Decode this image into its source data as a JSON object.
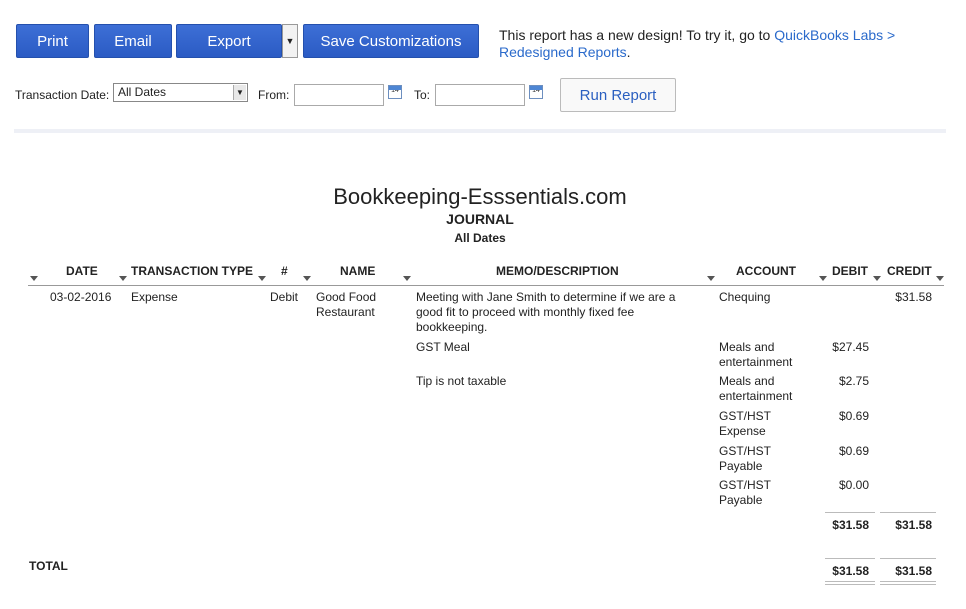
{
  "toolbar": {
    "print_label": "Print",
    "email_label": "Email",
    "export_label": "Export",
    "save_label": "Save Customizations"
  },
  "notice": {
    "text": "This report has a new design! To try it, go to ",
    "link": "QuickBooks Labs > Redesigned Reports",
    "end": "."
  },
  "filters": {
    "transaction_date_label": "Transaction Date:",
    "transaction_date_value": "All Dates",
    "from_label": "From:",
    "from_value": "",
    "to_label": "To:",
    "to_value": "",
    "calendar_day": "14",
    "run_label": "Run Report"
  },
  "report": {
    "company": "Bookkeeping-Esssentials.com",
    "title": "JOURNAL",
    "period": "All Dates",
    "columns": [
      "DATE",
      "TRANSACTION TYPE",
      "#",
      "NAME",
      "MEMO/DESCRIPTION",
      "ACCOUNT",
      "DEBIT",
      "CREDIT"
    ],
    "rows": [
      {
        "date": "03-02-2016",
        "type": "Expense",
        "num": "Debit",
        "name": "Good Food Restaurant",
        "memo": "Meeting with Jane Smith to determine if we are a good fit to proceed with monthly fixed fee bookkeeping.",
        "account": "Chequing",
        "debit": "",
        "credit": "$31.58"
      },
      {
        "memo": "GST Meal",
        "account": "Meals and entertainment",
        "debit": "$27.45",
        "credit": ""
      },
      {
        "memo": "Tip is not taxable",
        "account": "Meals and entertainment",
        "debit": "$2.75",
        "credit": ""
      },
      {
        "memo": "",
        "account": "GST/HST Expense",
        "debit": "$0.69",
        "credit": ""
      },
      {
        "memo": "",
        "account": "GST/HST Payable",
        "debit": "$0.69",
        "credit": ""
      },
      {
        "memo": "",
        "account": "GST/HST Payable",
        "debit": "$0.00",
        "credit": ""
      }
    ],
    "subtotal": {
      "debit": "$31.58",
      "credit": "$31.58"
    },
    "total": {
      "label": "TOTAL",
      "debit": "$31.58",
      "credit": "$31.58"
    }
  },
  "colors": {
    "button": "#2b5bc4",
    "link": "#2a6acb"
  }
}
